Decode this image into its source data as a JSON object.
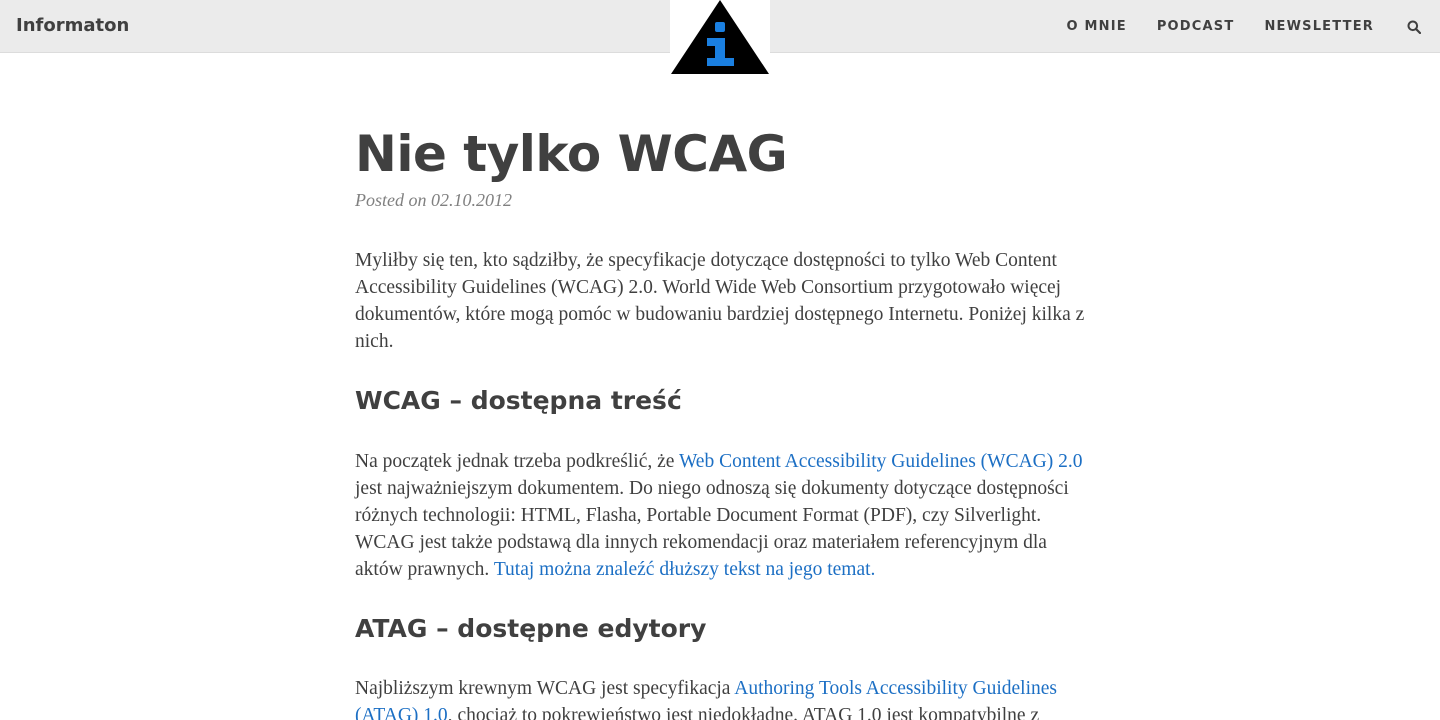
{
  "navbar": {
    "brand": "Informaton",
    "links": [
      "O MNIE",
      "PODCAST",
      "NEWSLETTER"
    ],
    "search_icon": "search-icon",
    "logo_colors": {
      "triangle": "#000000",
      "letter": "#1a7fe0"
    }
  },
  "post": {
    "title": "Nie tylko WCAG",
    "meta": "Posted on 02.10.2012",
    "intro": "Myliłby się ten, kto sądziłby, że specyfikacje dotyczące dostępności to tylko Web Content Accessibility Guidelines (WCAG) 2.0. World Wide Web Consortium przygotowało więcej dokumentów, które mogą pomóc w budowaniu bardziej dostępnego Internetu. Poniżej kilka z nich.",
    "section1": {
      "heading": "WCAG – dostępna treść",
      "text_before": "Na początek jednak trzeba podkreślić, że ",
      "link1": "Web Content Accessibility Guidelines (WCAG) 2.0",
      "text_middle": " jest najważniejszym dokumentem. Do niego odnoszą się dokumenty dotyczące dostępności różnych technologii: HTML, Flasha, Portable Document Format (PDF), czy Silverlight. WCAG jest także podstawą dla innych rekomendacji oraz materiałem referencyjnym dla aktów prawnych. ",
      "link2": "Tutaj można znaleźć dłuższy tekst na jego temat."
    },
    "section2": {
      "heading": "ATAG – dostępne edytory",
      "text_before": "Najbliższym krewnym WCAG jest specyfikacja ",
      "link1": "Authoring Tools Accessibility Guidelines (ATAG) 1.0",
      "text_after": ", chociaż to pokrewieństwo jest niedokładne. ATAG 1.0 jest kompatybilne z"
    }
  },
  "colors": {
    "link": "#1c6fc4",
    "text": "#404040",
    "navbar_bg": "#ebebeb"
  }
}
